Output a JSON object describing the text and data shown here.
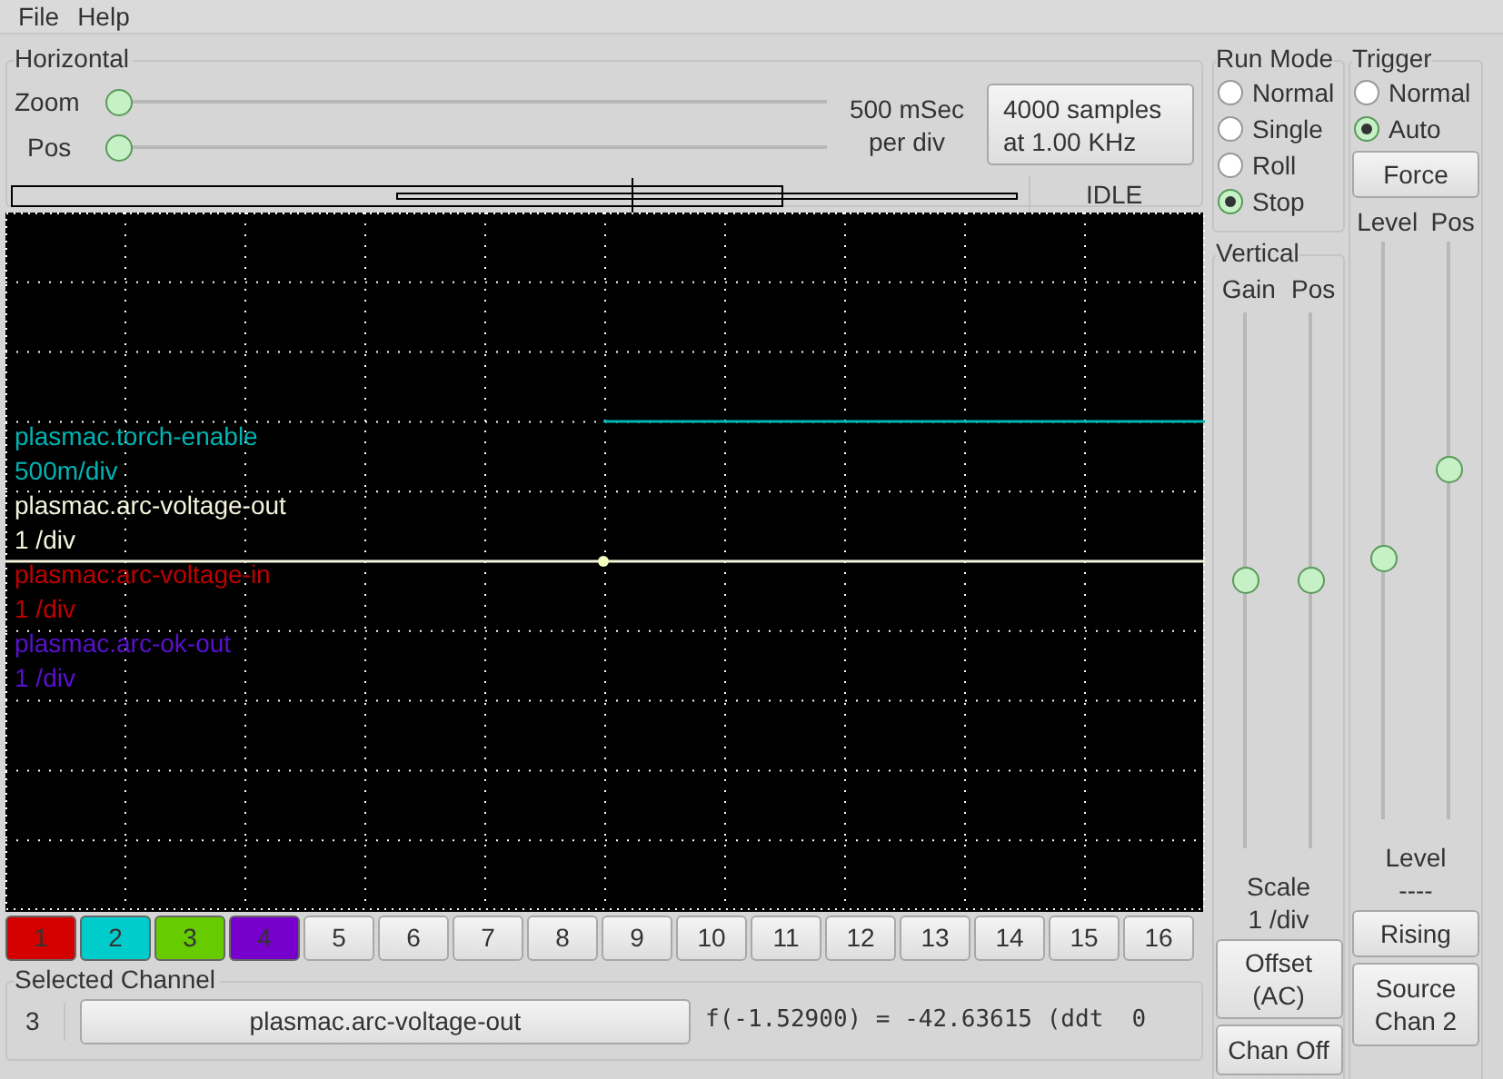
{
  "menu": [
    "File",
    "Help"
  ],
  "horizontal": {
    "title": "Horizontal",
    "zoom": {
      "label": "Zoom",
      "level": 0
    },
    "pos": {
      "label": "Pos",
      "level": 0
    },
    "rate": [
      "500 mSec",
      "per div"
    ],
    "samples_button": [
      "4000 samples",
      "at 1.00 KHz"
    ],
    "status": "IDLE"
  },
  "traces": [
    {
      "name": "plasmac.torch-enable",
      "scale": "500m/div",
      "color": "#00b4b4"
    },
    {
      "name": "plasmac.arc-voltage-out",
      "scale": "1 /div",
      "color": "#f4f4dc"
    },
    {
      "name": "plasmac:arc-voltage-in",
      "scale": "1 /div",
      "color": "#c00000"
    },
    {
      "name": "plasmac.arc-ok-out",
      "scale": "1 /div",
      "color": "#5a10d0"
    }
  ],
  "channels": [
    {
      "label": "1",
      "color": "#d40000"
    },
    {
      "label": "2",
      "color": "#00cccc"
    },
    {
      "label": "3",
      "color": "#66cc00"
    },
    {
      "label": "4",
      "color": "#7700cc"
    },
    {
      "label": "5"
    },
    {
      "label": "6"
    },
    {
      "label": "7"
    },
    {
      "label": "8"
    },
    {
      "label": "9"
    },
    {
      "label": "10"
    },
    {
      "label": "11"
    },
    {
      "label": "12"
    },
    {
      "label": "13"
    },
    {
      "label": "14"
    },
    {
      "label": "15"
    },
    {
      "label": "16"
    }
  ],
  "selected_channel": {
    "title": "Selected Channel",
    "number": "3",
    "name_button": "plasmac.arc-voltage-out",
    "readout": "f(-1.52900) = -42.63615 (ddt  0"
  },
  "run_mode": {
    "title": "Run Mode",
    "options": [
      {
        "label": "Normal",
        "selected": false
      },
      {
        "label": "Single",
        "selected": false
      },
      {
        "label": "Roll",
        "selected": false
      },
      {
        "label": "Stop",
        "selected": true
      }
    ]
  },
  "vertical": {
    "title": "Vertical",
    "gain_label": "Gain",
    "pos_label": "Pos",
    "gain": {
      "level": 0.5
    },
    "pos": {
      "level": 0.5
    },
    "scale_title": "Scale",
    "scale_value": "1 /div",
    "offset_button": [
      "Offset",
      "(AC)"
    ],
    "chan_off_button": "Chan Off"
  },
  "trigger": {
    "title": "Trigger",
    "options": [
      {
        "label": "Normal",
        "selected": false
      },
      {
        "label": "Auto",
        "selected": true
      }
    ],
    "force_button": "Force",
    "level_label": "Level",
    "pos_label": "Pos",
    "level_slider": {
      "level": 0.45
    },
    "pos_slider": {
      "level": 0.61
    },
    "level_title": "Level",
    "level_value": "----",
    "rising_button": "Rising",
    "source_button": [
      "Source",
      "Chan 2"
    ]
  }
}
